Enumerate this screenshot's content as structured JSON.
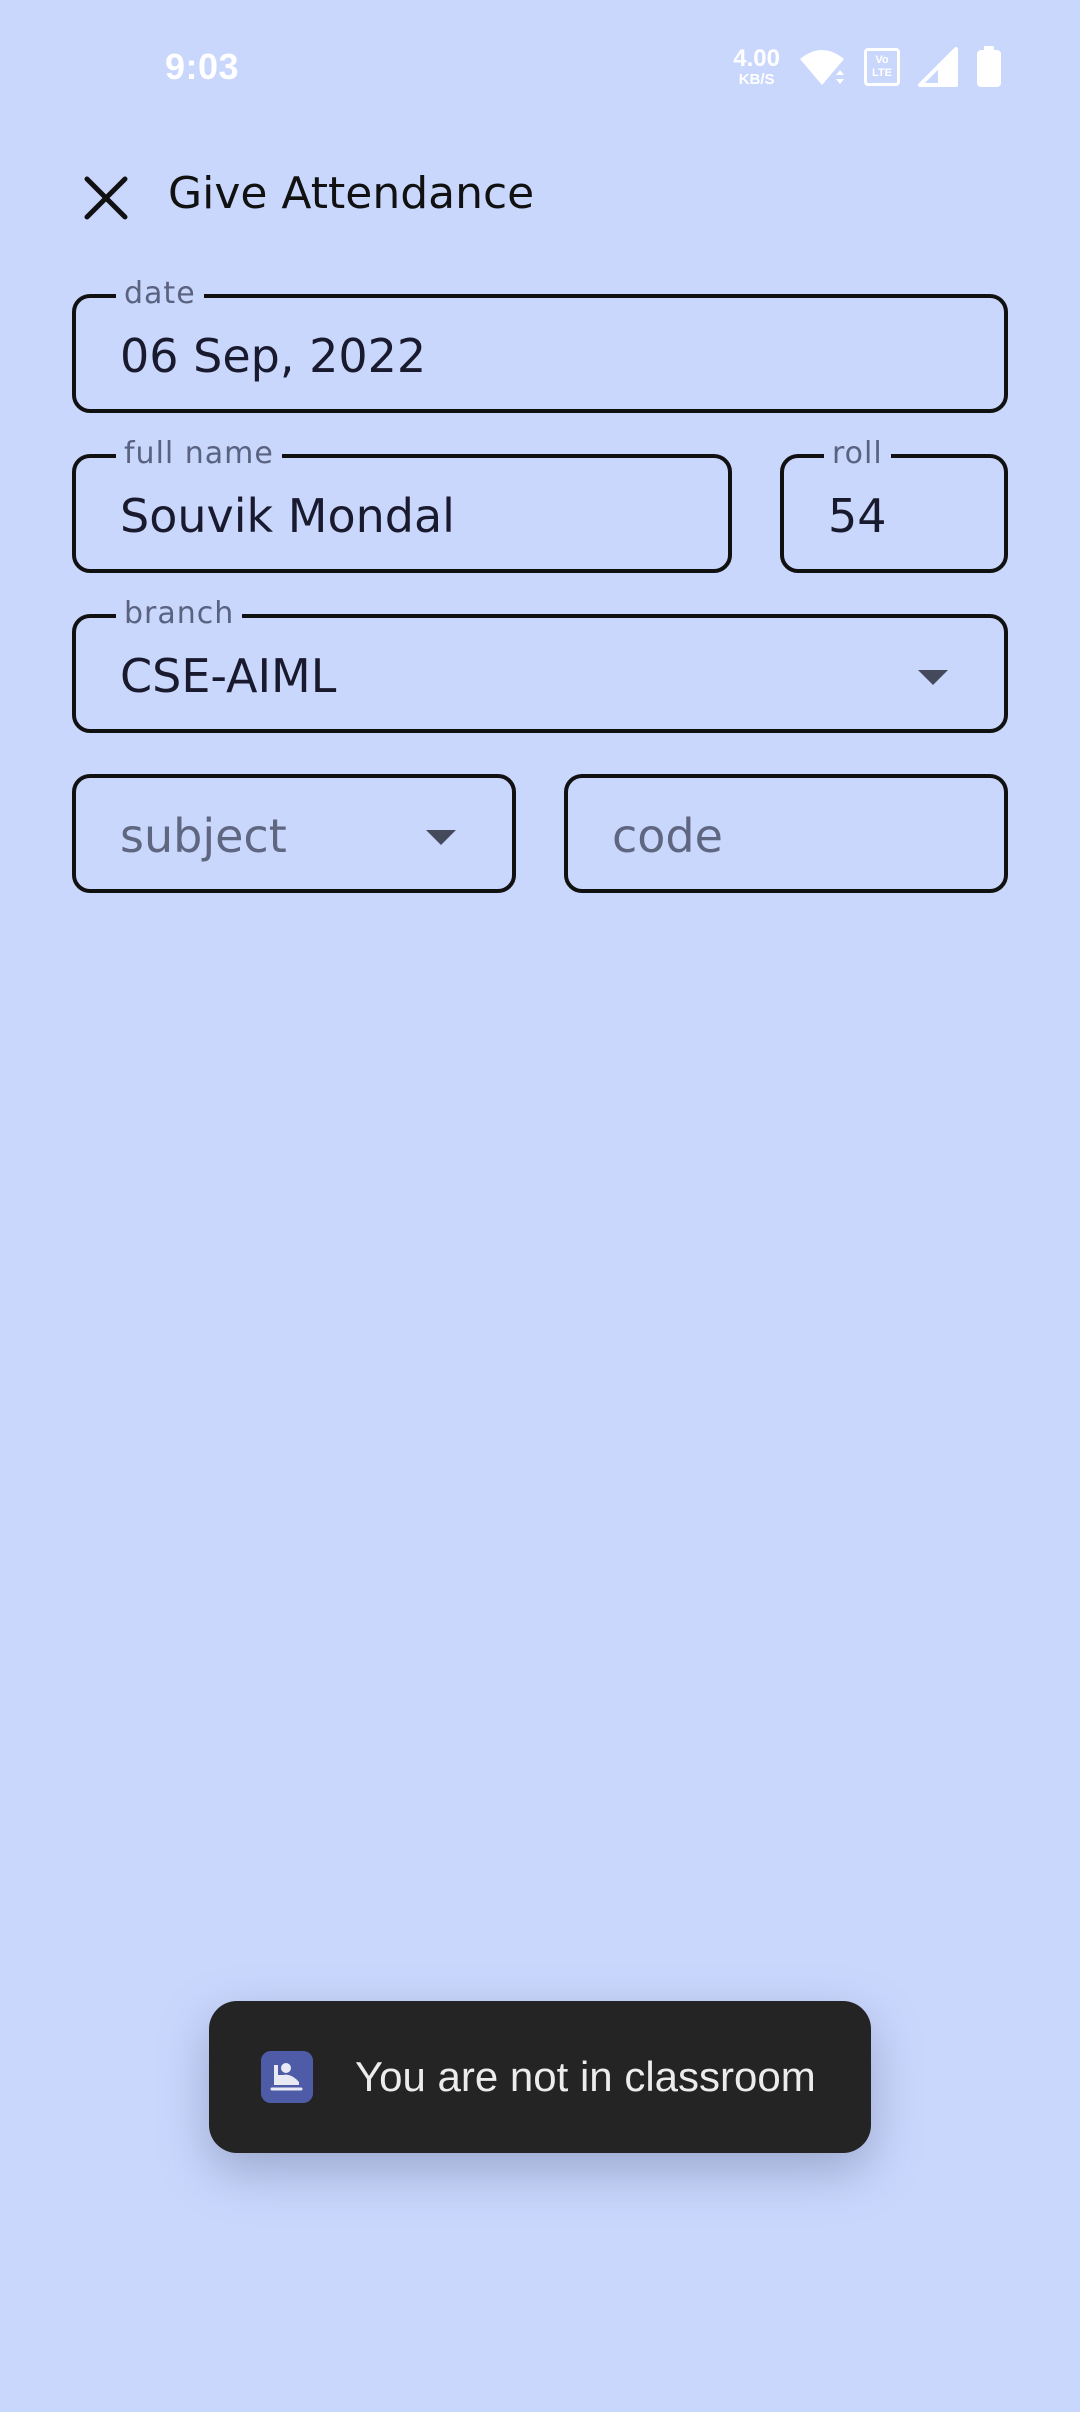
{
  "status_bar": {
    "time": "9:03",
    "net_speed_value": "4.00",
    "net_speed_unit": "KB/S",
    "volte_line1": "Vo",
    "volte_line2": "LTE",
    "icons": [
      "wifi-icon",
      "volte-icon",
      "signal-icon",
      "battery-icon"
    ]
  },
  "header": {
    "close_icon": "close-icon",
    "title": "Give Attendance"
  },
  "form": {
    "date": {
      "label": "date",
      "value": "06 Sep, 2022"
    },
    "full_name": {
      "label": "full name",
      "value": "Souvik Mondal"
    },
    "roll": {
      "label": "roll",
      "value": "54"
    },
    "branch": {
      "label": "branch",
      "value": "CSE-AIML",
      "icon": "dropdown-arrow-icon"
    },
    "subject": {
      "placeholder": "subject",
      "icon": "dropdown-arrow-icon"
    },
    "code": {
      "placeholder": "code"
    }
  },
  "toast": {
    "icon": "app-icon",
    "message": "You are not in classroom"
  },
  "colors": {
    "background": "#CAD7FD",
    "field_border": "#111111",
    "toast_background": "#242424",
    "toast_icon": "#4E5BA6"
  }
}
